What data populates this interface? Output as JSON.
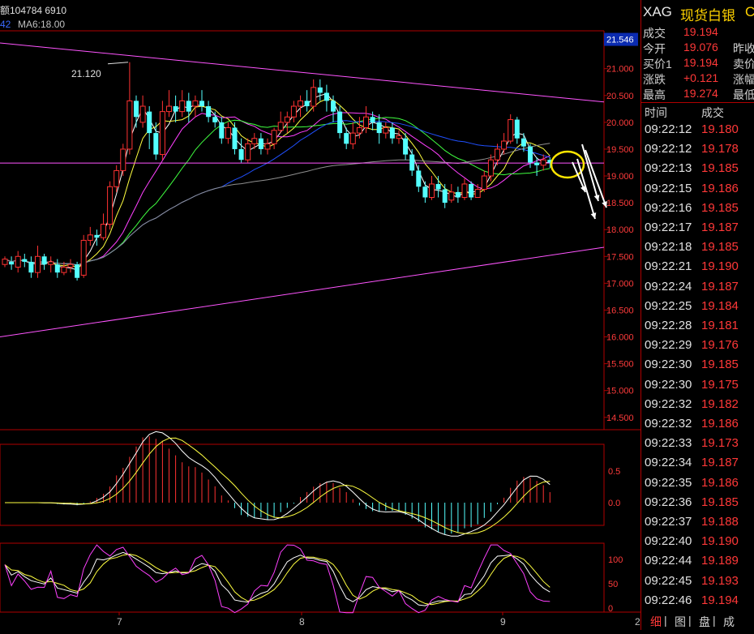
{
  "header": {
    "volume_label": "额104784 6910",
    "ma_prefix": "42",
    "ma_label": "MA6:18.00"
  },
  "chart": {
    "price_axis": [
      "21.000",
      "20.500",
      "20.000",
      "19.500",
      "19.000",
      "18.500",
      "18.000",
      "17.500",
      "17.000",
      "16.500",
      "16.000",
      "15.500",
      "15.000",
      "14.500"
    ],
    "current_price_tag": "21.546",
    "peak_annotation": "21.120",
    "macd_axis": [
      "0.5",
      "0.0"
    ],
    "kdj_axis": [
      "100",
      "50",
      "0"
    ],
    "date_labels": [
      "7",
      "8",
      "9"
    ],
    "corner_label": "2",
    "colors": {
      "up": "#ff3232",
      "down": "#54ffff",
      "grid": "#b00000",
      "axis_text": "#ff3b3b",
      "ma5": "#ffffff",
      "ma10": "#ffff40",
      "ma20": "#ff40ff",
      "ma30": "#40ff40",
      "ma60": "#2050ff",
      "ma120": "#909090"
    }
  },
  "sidebar": {
    "symbol": "XAG",
    "name": "现货白银",
    "name_suffix": "C",
    "quotes": [
      {
        "label": "成交",
        "value": "19.194",
        "label2": ""
      },
      {
        "label": "今开",
        "value": "19.076",
        "label2": "昨收"
      },
      {
        "label": "买价1",
        "value": "19.194",
        "label2": "卖价"
      },
      {
        "label": "涨跌",
        "value": "+0.121",
        "label2": "涨幅"
      },
      {
        "label": "最高",
        "value": "19.274",
        "label2": "最低"
      }
    ],
    "ticks_header": {
      "time": "时间",
      "price": "成交"
    },
    "ticks": [
      {
        "time": "09:22:12",
        "price": "19.180"
      },
      {
        "time": "09:22:12",
        "price": "19.178"
      },
      {
        "time": "09:22:13",
        "price": "19.185"
      },
      {
        "time": "09:22:15",
        "price": "19.186"
      },
      {
        "time": "09:22:16",
        "price": "19.185"
      },
      {
        "time": "09:22:17",
        "price": "19.187"
      },
      {
        "time": "09:22:18",
        "price": "19.185"
      },
      {
        "time": "09:22:21",
        "price": "19.190"
      },
      {
        "time": "09:22:24",
        "price": "19.187"
      },
      {
        "time": "09:22:25",
        "price": "19.184"
      },
      {
        "time": "09:22:28",
        "price": "19.181"
      },
      {
        "time": "09:22:29",
        "price": "19.176"
      },
      {
        "time": "09:22:30",
        "price": "19.185"
      },
      {
        "time": "09:22:30",
        "price": "19.175"
      },
      {
        "time": "09:22:32",
        "price": "19.182"
      },
      {
        "time": "09:22:32",
        "price": "19.186"
      },
      {
        "time": "09:22:33",
        "price": "19.173"
      },
      {
        "time": "09:22:34",
        "price": "19.187"
      },
      {
        "time": "09:22:35",
        "price": "19.186"
      },
      {
        "time": "09:22:36",
        "price": "19.185"
      },
      {
        "time": "09:22:37",
        "price": "19.188"
      },
      {
        "time": "09:22:40",
        "price": "19.190"
      },
      {
        "time": "09:22:44",
        "price": "19.189"
      },
      {
        "time": "09:22:45",
        "price": "19.193"
      },
      {
        "time": "09:22:46",
        "price": "19.194"
      }
    ],
    "tabs": [
      "细",
      "图",
      "盘",
      "成"
    ]
  },
  "chart_data": {
    "type": "candlestick",
    "ylim": [
      14.3,
      21.6
    ],
    "candles": [
      [
        17.35,
        17.45,
        17.3,
        17.5
      ],
      [
        17.4,
        17.35,
        17.25,
        17.5
      ],
      [
        17.3,
        17.5,
        17.2,
        17.6
      ],
      [
        17.45,
        17.4,
        17.3,
        17.55
      ],
      [
        17.4,
        17.2,
        17.1,
        17.5
      ],
      [
        17.2,
        17.5,
        17.1,
        17.7
      ],
      [
        17.5,
        17.35,
        17.25,
        17.55
      ],
      [
        17.35,
        17.4,
        17.2,
        17.5
      ],
      [
        17.35,
        17.2,
        17.1,
        17.45
      ],
      [
        17.2,
        17.3,
        17.15,
        17.4
      ],
      [
        17.3,
        17.35,
        17.2,
        17.45
      ],
      [
        17.35,
        17.1,
        17.05,
        17.4
      ],
      [
        17.15,
        17.8,
        17.1,
        17.9
      ],
      [
        17.8,
        17.9,
        17.7,
        18.05
      ],
      [
        17.9,
        17.85,
        17.7,
        18.0
      ],
      [
        17.85,
        18.1,
        17.8,
        18.3
      ],
      [
        18.1,
        18.8,
        18.0,
        18.9
      ],
      [
        18.8,
        19.1,
        18.7,
        19.2
      ],
      [
        19.1,
        19.5,
        19.0,
        19.6
      ],
      [
        19.5,
        20.4,
        19.4,
        21.12
      ],
      [
        20.4,
        20.1,
        19.9,
        20.5
      ],
      [
        20.0,
        20.3,
        19.9,
        20.5
      ],
      [
        20.2,
        19.8,
        19.5,
        20.3
      ],
      [
        19.8,
        19.4,
        19.3,
        20.0
      ],
      [
        19.4,
        20.2,
        19.3,
        20.4
      ],
      [
        20.2,
        20.3,
        20.1,
        20.6
      ],
      [
        20.3,
        20.2,
        20.0,
        20.5
      ],
      [
        20.2,
        20.4,
        20.1,
        20.6
      ],
      [
        20.4,
        20.2,
        20.0,
        20.55
      ],
      [
        20.3,
        20.4,
        20.1,
        20.5
      ],
      [
        20.4,
        20.3,
        20.2,
        20.6
      ],
      [
        20.3,
        20.1,
        20.0,
        20.4
      ],
      [
        20.1,
        20.0,
        19.9,
        20.2
      ],
      [
        20.0,
        19.7,
        19.6,
        20.1
      ],
      [
        19.7,
        19.9,
        19.6,
        20.0
      ],
      [
        19.9,
        19.5,
        19.4,
        20.0
      ],
      [
        19.5,
        19.3,
        19.25,
        19.7
      ],
      [
        19.3,
        19.6,
        19.25,
        19.7
      ],
      [
        19.6,
        19.7,
        19.5,
        19.8
      ],
      [
        19.7,
        19.5,
        19.4,
        19.8
      ],
      [
        19.5,
        19.6,
        19.4,
        19.7
      ],
      [
        19.6,
        19.85,
        19.5,
        19.9
      ],
      [
        19.85,
        20.0,
        19.8,
        20.2
      ],
      [
        20.0,
        20.1,
        19.8,
        20.2
      ],
      [
        20.1,
        20.3,
        20.0,
        20.4
      ],
      [
        20.3,
        20.4,
        20.1,
        20.5
      ],
      [
        20.4,
        20.3,
        20.2,
        20.6
      ],
      [
        20.3,
        20.65,
        20.2,
        20.8
      ],
      [
        20.65,
        20.55,
        20.4,
        20.8
      ],
      [
        20.55,
        20.4,
        20.2,
        20.7
      ],
      [
        20.4,
        20.2,
        20.0,
        20.5
      ],
      [
        20.2,
        19.8,
        19.7,
        20.3
      ],
      [
        19.8,
        19.6,
        19.5,
        19.9
      ],
      [
        19.6,
        19.8,
        19.5,
        20.0
      ],
      [
        19.8,
        19.9,
        19.7,
        20.1
      ],
      [
        19.9,
        20.1,
        19.8,
        20.3
      ],
      [
        20.1,
        20.0,
        19.85,
        20.2
      ],
      [
        20.0,
        19.8,
        19.6,
        20.15
      ],
      [
        19.8,
        19.9,
        19.7,
        20.0
      ],
      [
        19.9,
        19.7,
        19.6,
        20.0
      ],
      [
        19.7,
        19.75,
        19.6,
        19.85
      ],
      [
        19.7,
        19.4,
        19.3,
        19.8
      ],
      [
        19.4,
        19.1,
        19.0,
        19.5
      ],
      [
        19.1,
        18.8,
        18.7,
        19.2
      ],
      [
        18.8,
        18.6,
        18.5,
        18.9
      ],
      [
        18.6,
        18.85,
        18.55,
        19.0
      ],
      [
        18.85,
        18.75,
        18.6,
        19.0
      ],
      [
        18.75,
        18.5,
        18.4,
        18.85
      ],
      [
        18.55,
        18.7,
        18.5,
        18.85
      ],
      [
        18.7,
        18.6,
        18.5,
        18.8
      ],
      [
        18.6,
        18.85,
        18.55,
        18.95
      ],
      [
        18.85,
        18.6,
        18.55,
        18.9
      ],
      [
        18.6,
        18.75,
        18.6,
        18.85
      ],
      [
        18.75,
        19.0,
        18.7,
        19.1
      ],
      [
        19.0,
        19.3,
        18.9,
        19.4
      ],
      [
        19.3,
        19.5,
        19.2,
        19.6
      ],
      [
        19.5,
        19.65,
        19.4,
        19.8
      ],
      [
        19.65,
        20.05,
        19.6,
        20.15
      ],
      [
        20.05,
        19.7,
        19.6,
        20.1
      ],
      [
        19.7,
        19.55,
        19.45,
        19.8
      ],
      [
        19.55,
        19.25,
        19.15,
        19.6
      ],
      [
        19.25,
        19.2,
        19.0,
        19.35
      ],
      [
        19.2,
        19.3,
        19.1,
        19.4
      ],
      [
        19.3,
        19.25,
        19.15,
        19.35
      ]
    ]
  }
}
